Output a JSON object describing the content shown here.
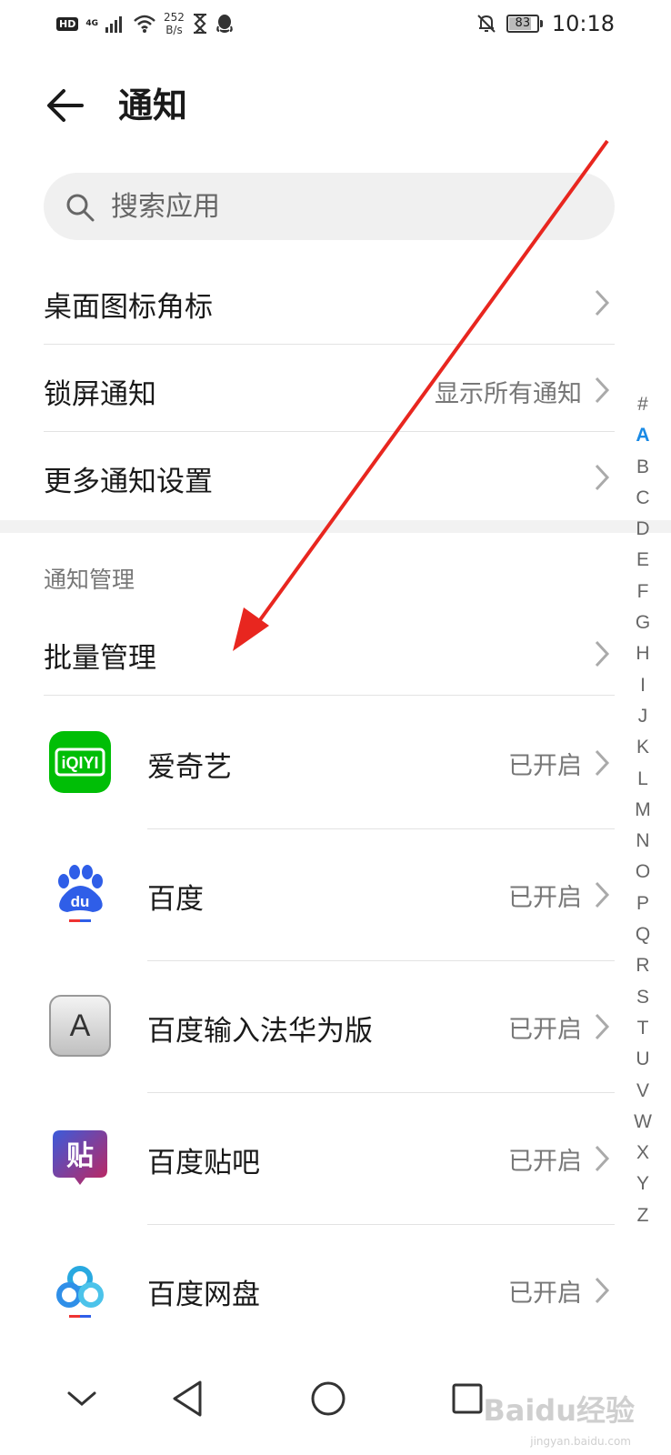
{
  "status_bar": {
    "hd": "HD",
    "network": "4G",
    "speed_value": "252",
    "speed_unit": "B/s",
    "battery": "83",
    "battery_level": 0.83,
    "time": "10:18"
  },
  "header": {
    "title": "通知"
  },
  "search": {
    "placeholder": "搜索应用"
  },
  "settings": {
    "badge_label": "桌面图标角标",
    "lockscreen_label": "锁屏通知",
    "lockscreen_value": "显示所有通知",
    "more_label": "更多通知设置"
  },
  "section": {
    "title": "通知管理",
    "batch_label": "批量管理"
  },
  "apps": [
    {
      "name": "爱奇艺",
      "status": "已开启"
    },
    {
      "name": "百度",
      "status": "已开启"
    },
    {
      "name": "百度输入法华为版",
      "status": "已开启"
    },
    {
      "name": "百度贴吧",
      "status": "已开启"
    },
    {
      "name": "百度网盘",
      "status": "已开启"
    }
  ],
  "app_icon_text": {
    "iqiyi": "iQIYI",
    "baidu": "du",
    "input": "A",
    "tieba": "贴"
  },
  "alphabet": [
    "#",
    "A",
    "B",
    "C",
    "D",
    "E",
    "F",
    "G",
    "H",
    "I",
    "J",
    "K",
    "L",
    "M",
    "N",
    "O",
    "P",
    "Q",
    "R",
    "S",
    "T",
    "U",
    "V",
    "W",
    "X",
    "Y",
    "Z"
  ],
  "alphabet_active": "A",
  "watermark": {
    "brand": "Baidu经验",
    "url": "jingyan.baidu.com"
  },
  "colors": {
    "accent": "#1a8ae5",
    "iqiyi_green": "#00be06",
    "arrow_red": "#e8261f"
  }
}
